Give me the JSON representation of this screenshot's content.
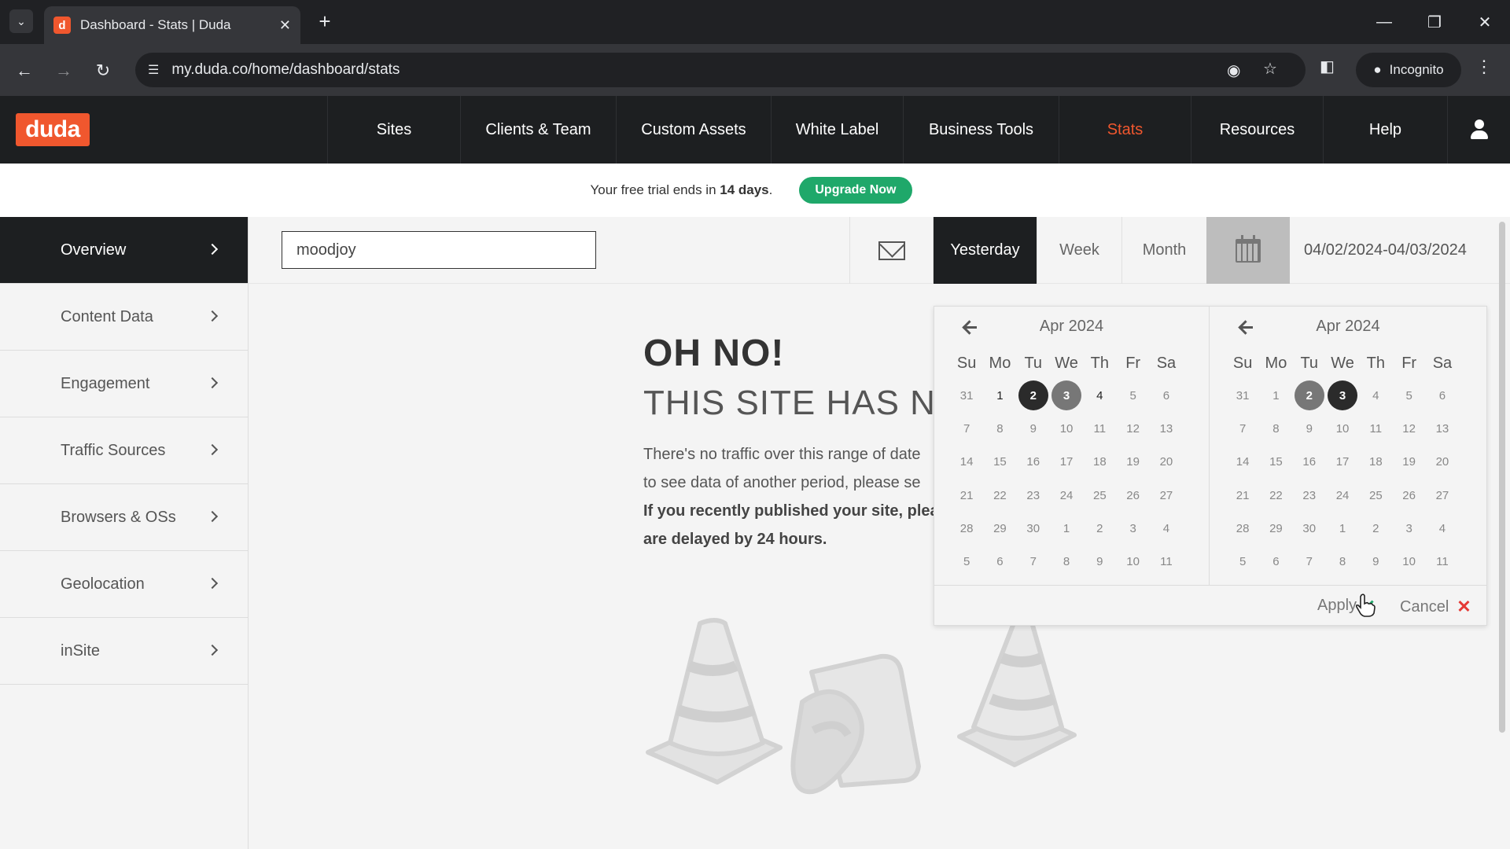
{
  "browser": {
    "tab_title": "Dashboard - Stats | Duda",
    "favicon_letter": "d",
    "url": "my.duda.co/home/dashboard/stats",
    "incognito_label": "Incognito"
  },
  "header": {
    "logo": "duda",
    "nav": [
      "Sites",
      "Clients & Team",
      "Custom Assets",
      "White Label",
      "Business Tools",
      "Stats",
      "Resources",
      "Help"
    ],
    "active_nav": "Stats",
    "accent_color": "#f0572e"
  },
  "trial": {
    "text_prefix": "Your free trial ends in ",
    "days": "14 days",
    "text_suffix": ".",
    "button": "Upgrade Now"
  },
  "sidebar": {
    "items": [
      "Overview",
      "Content Data",
      "Engagement",
      "Traffic Sources",
      "Browsers & OSs",
      "Geolocation",
      "inSite"
    ],
    "active": "Overview"
  },
  "toolbar": {
    "site_value": "moodjoy",
    "ranges": [
      "Yesterday",
      "Week",
      "Month"
    ],
    "active_range": "Yesterday",
    "date_range": "04/02/2024-04/03/2024"
  },
  "empty_state": {
    "title": "OH NO!",
    "subtitle": "THIS SITE HAS N",
    "line1": "There's no traffic over this range of date",
    "line2": "to see data of another period, please se",
    "line3": "If you recently published your site, plea",
    "line4": "are delayed by 24 hours."
  },
  "date_picker": {
    "weekdays": [
      "Su",
      "Mo",
      "Tu",
      "We",
      "Th",
      "Fr",
      "Sa"
    ],
    "months": [
      {
        "label": "Apr 2024",
        "days": [
          "31",
          "1",
          "2",
          "3",
          "4",
          "5",
          "6",
          "7",
          "8",
          "9",
          "10",
          "11",
          "12",
          "13",
          "14",
          "15",
          "16",
          "17",
          "18",
          "19",
          "20",
          "21",
          "22",
          "23",
          "24",
          "25",
          "26",
          "27",
          "28",
          "29",
          "30",
          "1",
          "2",
          "3",
          "4",
          "5",
          "6",
          "7",
          "8",
          "9",
          "10",
          "11"
        ],
        "current_flags": [
          0,
          1,
          1,
          1,
          1,
          0,
          0,
          0,
          0,
          0,
          0,
          0,
          0,
          0,
          0,
          0,
          0,
          0,
          0,
          0,
          0,
          0,
          0,
          0,
          0,
          0,
          0,
          0,
          0,
          0,
          0,
          0,
          0,
          0,
          0,
          0,
          0,
          0,
          0,
          0,
          0,
          0
        ],
        "dark": 2,
        "gray": 3
      },
      {
        "label": "Apr 2024",
        "days": [
          "31",
          "1",
          "2",
          "3",
          "4",
          "5",
          "6",
          "7",
          "8",
          "9",
          "10",
          "11",
          "12",
          "13",
          "14",
          "15",
          "16",
          "17",
          "18",
          "19",
          "20",
          "21",
          "22",
          "23",
          "24",
          "25",
          "26",
          "27",
          "28",
          "29",
          "30",
          "1",
          "2",
          "3",
          "4",
          "5",
          "6",
          "7",
          "8",
          "9",
          "10",
          "11"
        ],
        "current_flags": [
          0,
          0,
          1,
          1,
          0,
          0,
          0,
          0,
          0,
          0,
          0,
          0,
          0,
          0,
          0,
          0,
          0,
          0,
          0,
          0,
          0,
          0,
          0,
          0,
          0,
          0,
          0,
          0,
          0,
          0,
          0,
          0,
          0,
          0,
          0,
          0,
          0,
          0,
          0,
          0,
          0,
          0
        ],
        "dark": 3,
        "gray": 2
      }
    ],
    "apply": "Apply",
    "cancel": "Cancel"
  }
}
